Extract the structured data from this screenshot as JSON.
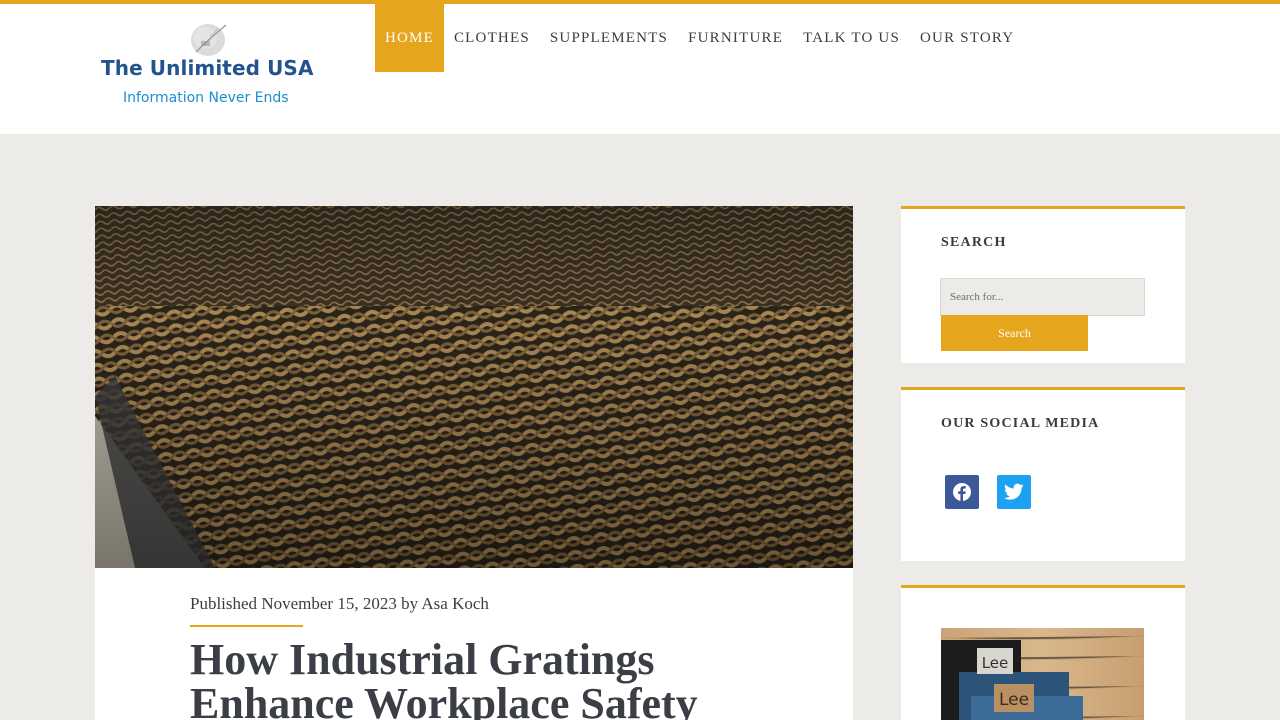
{
  "colors": {
    "accent": "#e5a51c",
    "logo_title": "#23538f",
    "logo_tagline": "#1a8fd1",
    "facebook": "#3b5998",
    "twitter": "#1da1f2"
  },
  "brand": {
    "title": "The Unlimited USA",
    "tagline": "Information Never Ends",
    "icon": "pen-quill-logo"
  },
  "nav": {
    "items": [
      {
        "label": "HOME",
        "active": true
      },
      {
        "label": "CLOTHES",
        "active": false
      },
      {
        "label": "SUPPLEMENTS",
        "active": false
      },
      {
        "label": "FURNITURE",
        "active": false
      },
      {
        "label": "TALK TO US",
        "active": false
      },
      {
        "label": "OUR STORY",
        "active": false
      }
    ]
  },
  "article": {
    "image": "rusted-metal-grating-photo",
    "meta": {
      "prefix": "Published",
      "date": "November 15, 2023",
      "by": "by",
      "author": "Asa Koch"
    },
    "title": "How Industrial Gratings Enhance Workplace Safety"
  },
  "sidebar": {
    "search": {
      "title": "SEARCH",
      "placeholder": "Search for...",
      "button": "Search"
    },
    "social": {
      "title": "OUR SOCIAL MEDIA",
      "icons": [
        "facebook-icon",
        "twitter-icon"
      ]
    },
    "ad": {
      "image": "lee-jeans-photo",
      "labels": [
        "Lee",
        "Lee"
      ]
    }
  }
}
